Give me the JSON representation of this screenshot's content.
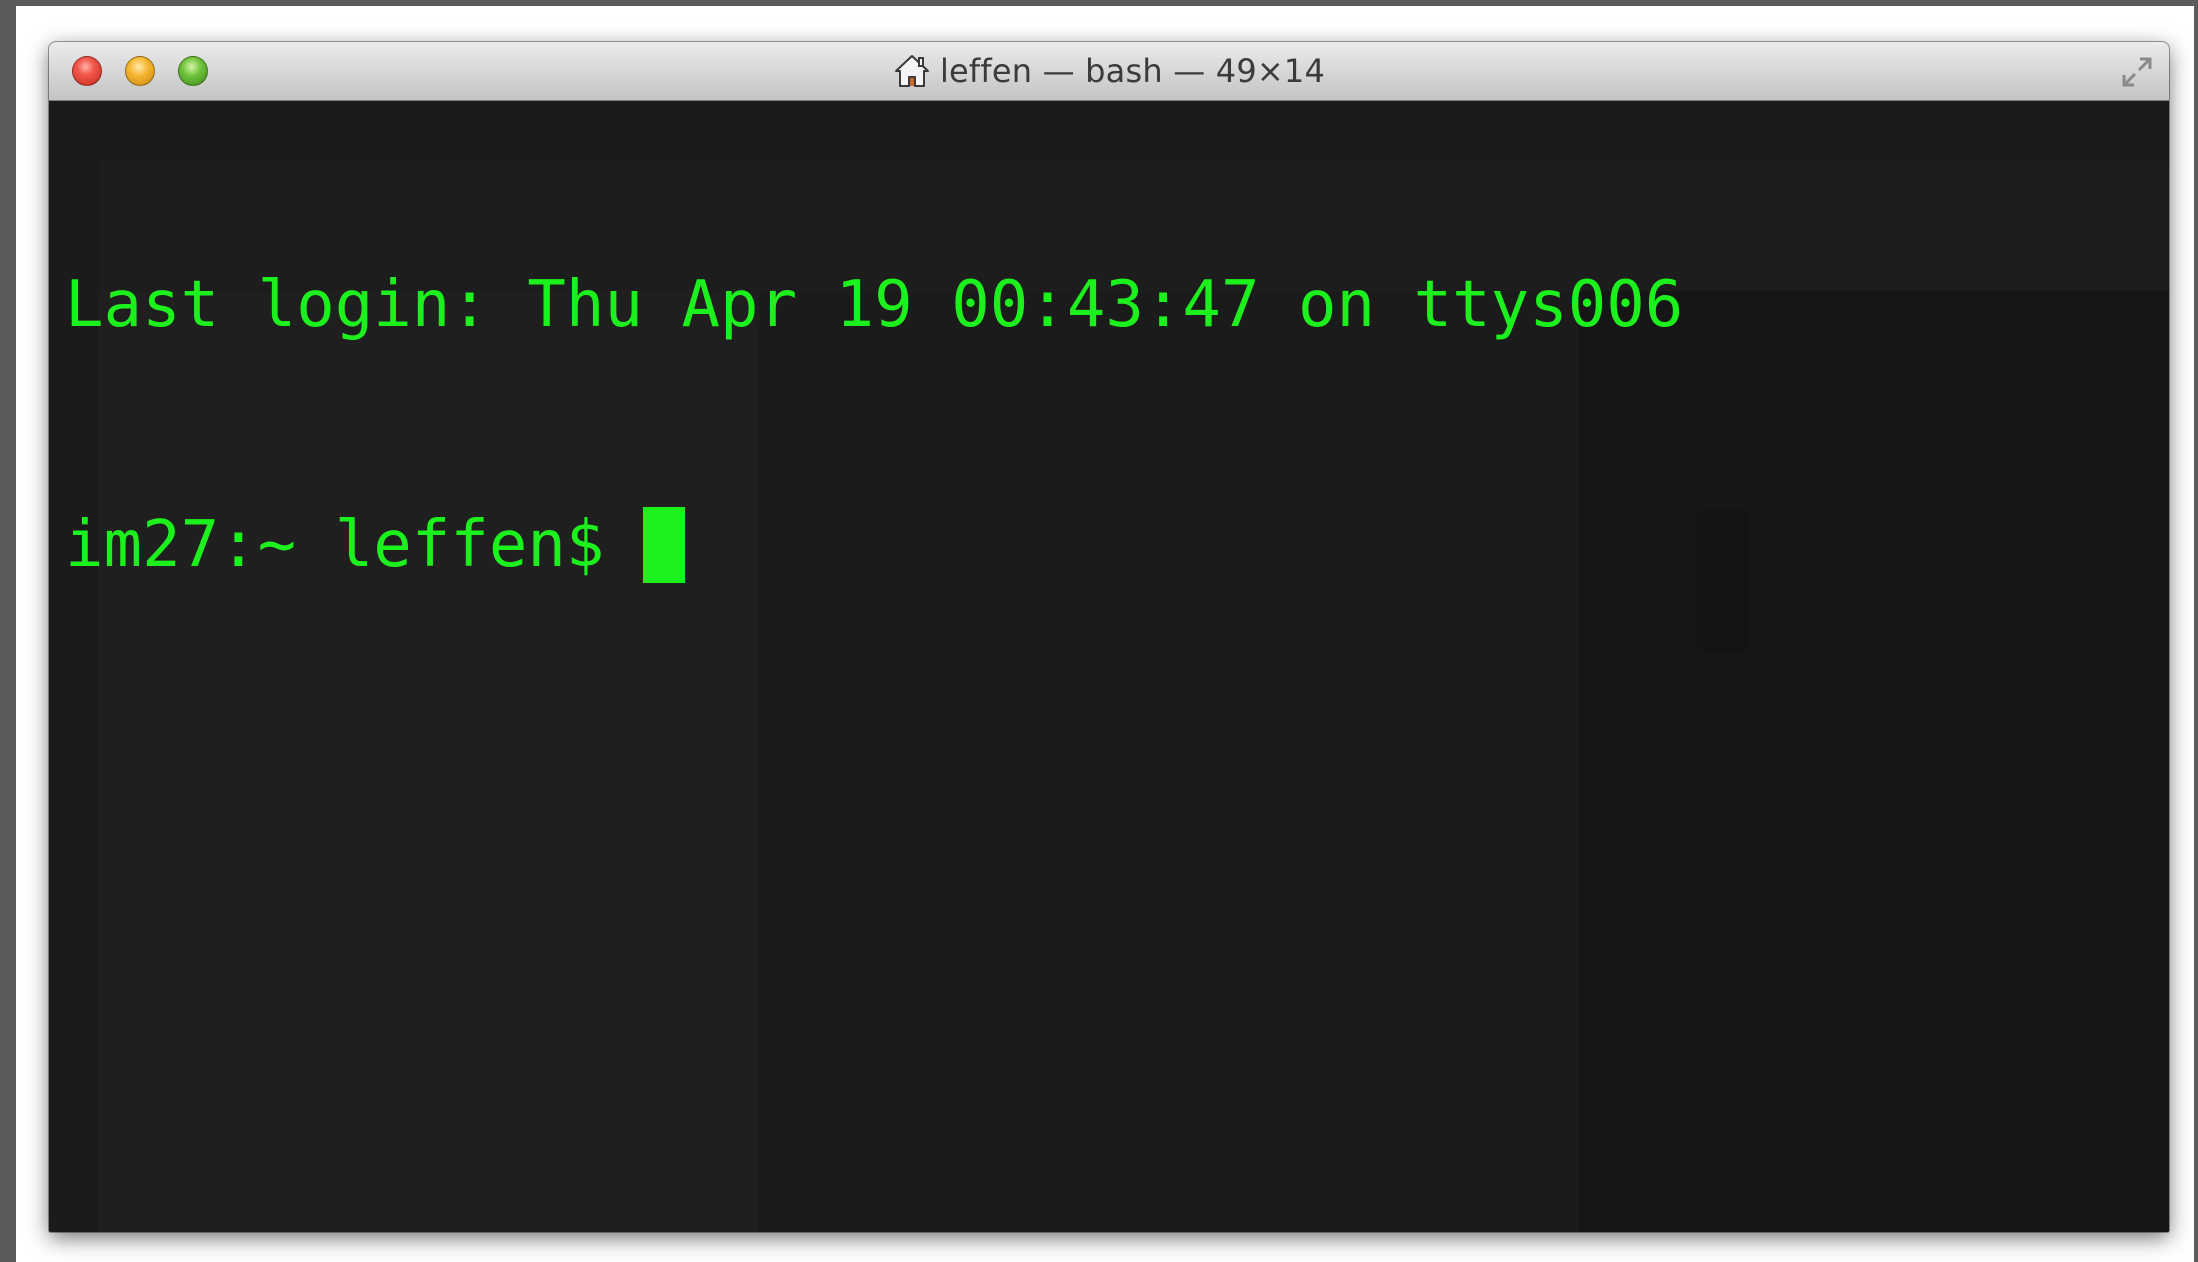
{
  "window": {
    "title": "leffen — bash — 49×14"
  },
  "terminal": {
    "lines": [
      "Last login: Thu Apr 19 00:43:47 on ttys006"
    ],
    "prompt": "im27:~ leffen$ "
  },
  "colors": {
    "terminal_background": "#1b1b1b",
    "terminal_text": "#1df11d",
    "cursor": "#1df11d"
  }
}
